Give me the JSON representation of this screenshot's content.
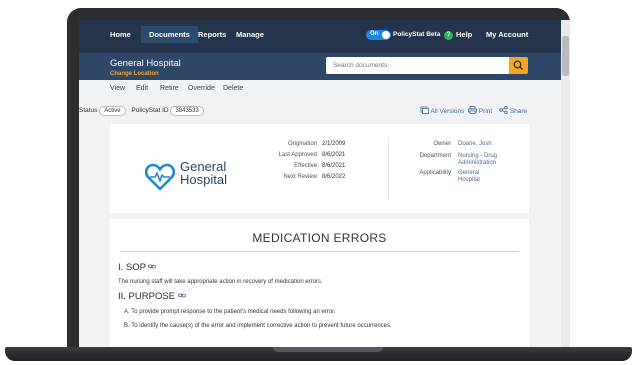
{
  "nav": {
    "items": [
      "Home",
      "Documents",
      "Reports",
      "Manage"
    ],
    "toggle_label": "On",
    "beta_label": "PolicyStat Beta",
    "beta_badge": "?",
    "help": "Help",
    "account": "My Account"
  },
  "header": {
    "hospital_name": "General Hospital",
    "change_location": "Change Location",
    "search_placeholder": "Search documents"
  },
  "toolbar": {
    "items": [
      "View",
      "Edit",
      "Retire",
      "Override",
      "Delete"
    ]
  },
  "status": {
    "label": "Status",
    "value": "Active",
    "id_label": "PolicyStat ID",
    "id_value": "3843533"
  },
  "actions": {
    "all_versions": "All Versions",
    "print": "Print",
    "share": "Share"
  },
  "logo": {
    "line1": "General",
    "line2": "Hospital"
  },
  "dates": [
    {
      "label": "Origination",
      "value": "2/1/2009"
    },
    {
      "label": "Last Approved",
      "value": "8/6/2021"
    },
    {
      "label": "Effective",
      "value": "8/6/2021"
    },
    {
      "label": "Next Review",
      "value": "8/6/2022"
    }
  ],
  "owner": {
    "owner_label": "Owner",
    "owner_value": "Doane, Josh",
    "department_label": "Department",
    "department_line1": "Nursing - Drug",
    "department_line2": "Administration",
    "applicability_label": "Applicability",
    "applicability_line1": "General",
    "applicability_line2": "Hospital"
  },
  "document": {
    "title": "MEDICATION ERRORS",
    "section1": "I. SOP",
    "section1_text": "The nursing staff will take appropriate action in recovery of medication errors.",
    "section2": "II. PURPOSE",
    "item_a": "A. To provide prompt response to the patient's medical needs following an error.",
    "item_b": "B. To identify the cause(s) of the error and implement corrective action to prevent future occurrences."
  },
  "colors": {
    "nav_bg": "#23344c",
    "header_bg": "#2e4767",
    "accent": "#f5a623",
    "link": "#4a6a92",
    "toggle": "#1e88e5",
    "beta_badge": "#2fb55a",
    "logo_heart": "#1e88c9"
  },
  "icons": [
    "search-icon",
    "versions-icon",
    "print-icon",
    "share-icon",
    "link-icon",
    "heart-logo-icon"
  ]
}
